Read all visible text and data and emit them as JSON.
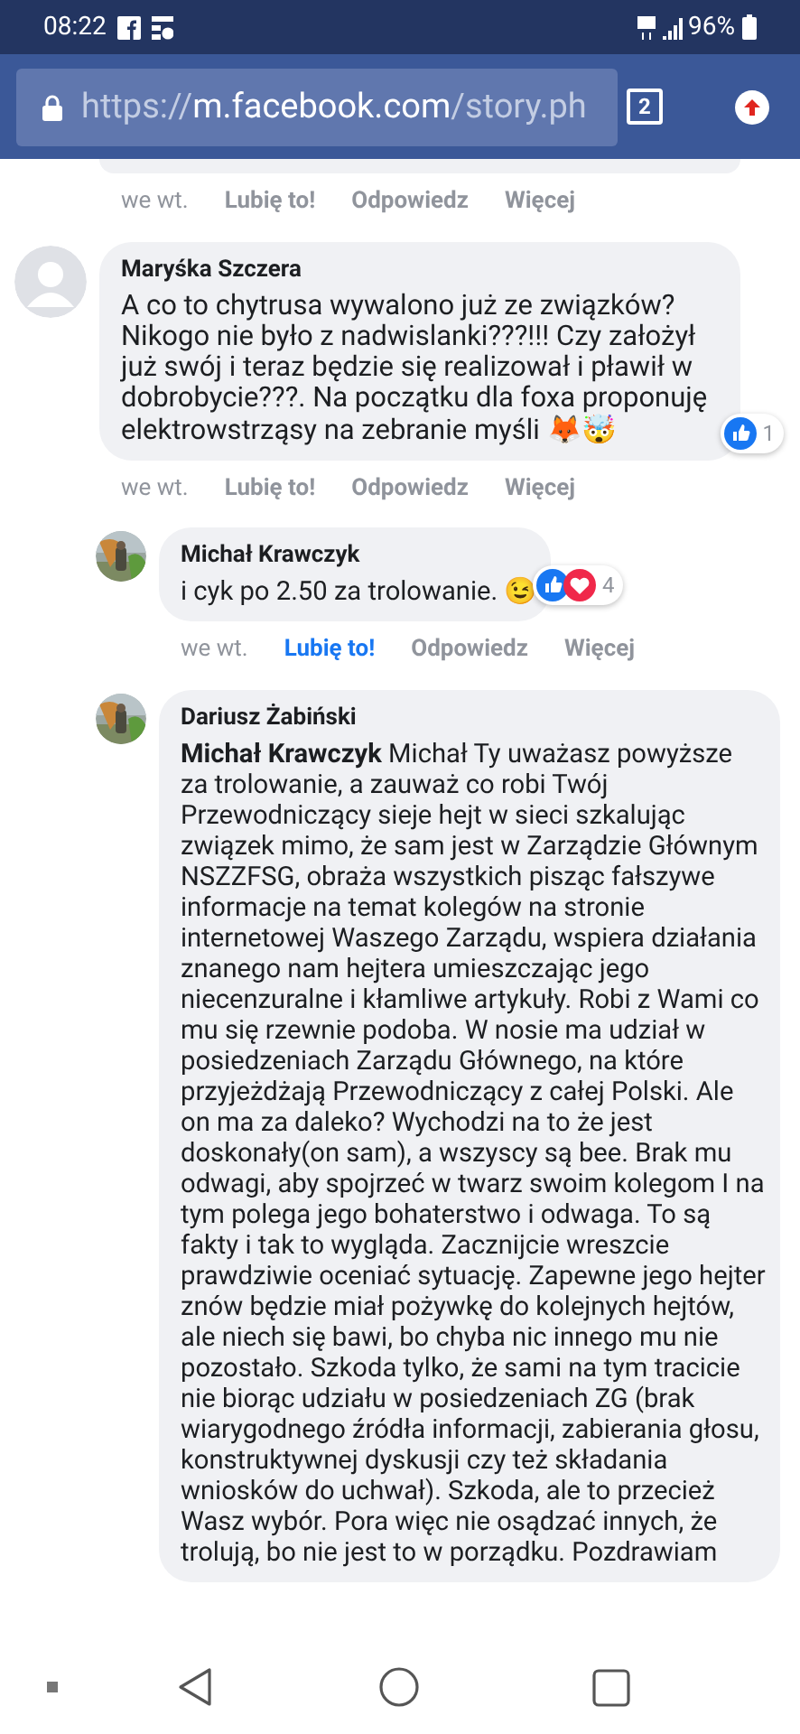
{
  "status_bar": {
    "time": "08:22",
    "battery": "96%"
  },
  "browser": {
    "url_scheme": "https://",
    "url_host": "m.facebook.com",
    "url_path": "/story.ph",
    "tab_count": "2"
  },
  "previous_comment_actions": {
    "time": "we wt.",
    "like": "Lubię to!",
    "liked": false,
    "reply": "Odpowiedz",
    "more": "Więcej"
  },
  "comments": [
    {
      "author": "Maryśka Szczera",
      "avatar": {
        "kind": "silhouette"
      },
      "text": "A co to chytrusa wywalono już ze związków? Nikogo nie było z nadwislanki???!!! Czy założył już swój i teraz będzie się realizował i pławił w dobrobycie???. Na początku dla foxa proponuję elektrowstrząsy na zebranie myśli 🦊🤯",
      "reactions": [
        {
          "kind": "like"
        }
      ],
      "reaction_count": "1",
      "time": "we wt.",
      "like": "Lubię to!",
      "liked": false,
      "reply": "Odpowiedz",
      "more": "Więcej",
      "children": [
        {
          "author": "Michał Krawczyk",
          "text": "i cyk po 2.50 za trolowanie. 😉",
          "reactions": [
            {
              "kind": "like"
            },
            {
              "kind": "love"
            }
          ],
          "reaction_count": "4",
          "time": "we wt.",
          "like": "Lubię to!",
          "liked": true,
          "reply": "Odpowiedz",
          "more": "Więcej"
        },
        {
          "author": "Dariusz Żabiński",
          "text": "**Michał Krawczyk** Michał Ty uważasz powyższe za trolowanie, a zauważ co robi Twój Przewodniczący sieje hejt w sieci szkalując związek mimo, że sam jest w Zarządzie Głównym NSZZFSG, obraża wszystkich pisząc fałszywe informacje na temat kolegów na stronie internetowej Waszego Zarządu, wspiera działania znanego nam hejtera umieszczając jego niecenzuralne i kłamliwe artykuły. Robi z Wami co mu się rzewnie podoba. W nosie ma udział w posiedzeniach Zarządu Głównego, na które przyjeżdżają Przewodniczący z całej Polski. Ale on ma za daleko? Wychodzi na to że jest doskonały(on sam), a wszyscy są bee. Brak mu odwagi, aby spojrzeć w twarz swoim kolegom I na tym polega jego bohaterstwo i odwaga. To są fakty i tak to wygląda. Zacznijcie wreszcie prawdziwie oceniać sytuację. Zapewne jego hejter znów będzie miał pożywkę do kolejnych hejtów, ale niech się bawi, bo chyba nic innego mu nie pozostało. Szkoda tylko, że sami na tym tracicie nie biorąc udziału w posiedzeniach ZG (brak wiarygodnego źródła informacji, zabierania głosu, konstruktywnej dyskusji czy też składania wniosków do uchwał). Szkoda, ale to przecież Wasz wybór. Pora więc nie osądzać innych, że trolują, bo nie jest to w porządku. Pozdrawiam"
        }
      ]
    }
  ]
}
